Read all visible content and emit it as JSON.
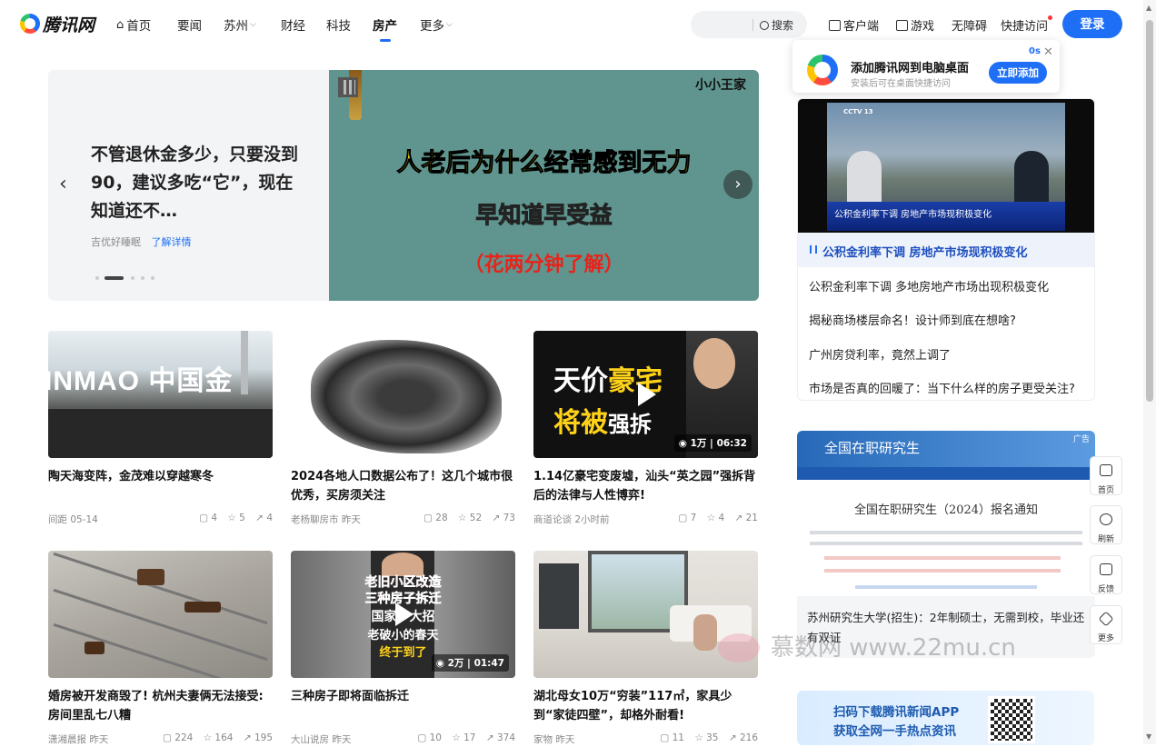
{
  "header": {
    "logo_text": "腾讯网",
    "nav": [
      {
        "label": "首页",
        "icon": "home-icon"
      },
      {
        "label": "要闻"
      },
      {
        "label": "苏州",
        "dropdown": true
      },
      {
        "label": "财经"
      },
      {
        "label": "科技"
      },
      {
        "label": "房产",
        "active": true
      },
      {
        "label": "更多",
        "dropdown": true
      }
    ],
    "search_label": "搜索",
    "links": [
      {
        "label": "客户端",
        "icon": "download-icon"
      },
      {
        "label": "游戏",
        "icon": "gamepad-icon"
      },
      {
        "label": "无障碍"
      },
      {
        "label": "快捷访问"
      }
    ],
    "login_label": "登录",
    "accent_color": "#1e6ff5"
  },
  "carousel": {
    "title": "不管退休金多少，只要没到90，建议多吃“它”，现在知道还不…",
    "source": "吉优好睡眠",
    "more_label": "了解详情",
    "image_headline": "人老后为什么经常感到无力",
    "image_sub": "早知道早受益",
    "image_note": "（花两分钟了解）",
    "image_brand": "小小王家",
    "active_slide": 2,
    "slide_count": 5
  },
  "cards": [
    {
      "title": "陶天海变阵，金茂难以穿越寒冬",
      "source": "间距 05-14",
      "comments": "4",
      "likes": "5",
      "shares": "4",
      "image_text": "INMAO 中国金"
    },
    {
      "title": "2024各地人口数据公布了！这几个城市很优秀，买房须关注",
      "source": "老杨聊房市 昨天",
      "comments": "28",
      "likes": "52",
      "shares": "73"
    },
    {
      "title": "1.14亿豪宅变废墟，汕头“英之园”强拆背后的法律与人性博弈!",
      "source": "商道论谈 2小时前",
      "comments": "7",
      "likes": "4",
      "shares": "21",
      "image_line1a": "天价",
      "image_line1b": "豪宅",
      "image_line2a": "将被",
      "image_line2b": "强拆",
      "views": "1万",
      "duration": "06:32"
    },
    {
      "title": "婚房被开发商毁了! 杭州夫妻俩无法接受:房间里乱七八糟",
      "source": "潇湘晨报 昨天",
      "comments": "224",
      "likes": "164",
      "shares": "195"
    },
    {
      "title": "三种房子即将面临拆迁",
      "source": "大山说房 昨天",
      "comments": "10",
      "likes": "17",
      "shares": "374",
      "image_lines": [
        "老旧小区改造",
        "三种房子拆迁",
        "国家一大招",
        "老破小的春天",
        "终于到了"
      ],
      "views": "2万",
      "duration": "01:47"
    },
    {
      "title": "湖北母女10万“穷装”117㎡，家具少到“家徒四壁”，却格外耐看!",
      "source": "家物 昨天",
      "comments": "11",
      "likes": "35",
      "shares": "216"
    }
  ],
  "popup": {
    "title": "添加腾讯网到电脑桌面",
    "subtitle": "安装后可在桌面快捷访问",
    "timer": "0s",
    "add_label": "立即添加"
  },
  "topic": {
    "video_caption": "公积金利率下调 房地产市场现积极变化",
    "tv_logo": "CCTV 13",
    "head": "公积金利率下调 房地产市场现积极变化",
    "items": [
      "公积金利率下调 多地房地产市场出现积极变化",
      "揭秘商场楼层命名！设计师到底在想啥?",
      "广州房贷利率，竟然上调了",
      "市场是否真的回暖了：当下什么样的房子更受关注?"
    ]
  },
  "ad": {
    "banner_title": "全国在职研究生",
    "tag": "广告",
    "notice": "全国在职研究生（2024）报名通知",
    "text": "苏州研究生大学(招生)：2年制硕士，无需到校，毕业还有双证"
  },
  "app_banner": {
    "line1": "扫码下载腾讯新闻APP",
    "line2": "获取全网一手热点资讯"
  },
  "tools": [
    {
      "label": "首页",
      "icon": "home-icon"
    },
    {
      "label": "刷新",
      "icon": "refresh-icon"
    },
    {
      "label": "反馈",
      "icon": "feedback-icon"
    },
    {
      "label": "更多",
      "icon": "more-icon"
    }
  ],
  "watermark": "慕数网 www.22mu.cn"
}
